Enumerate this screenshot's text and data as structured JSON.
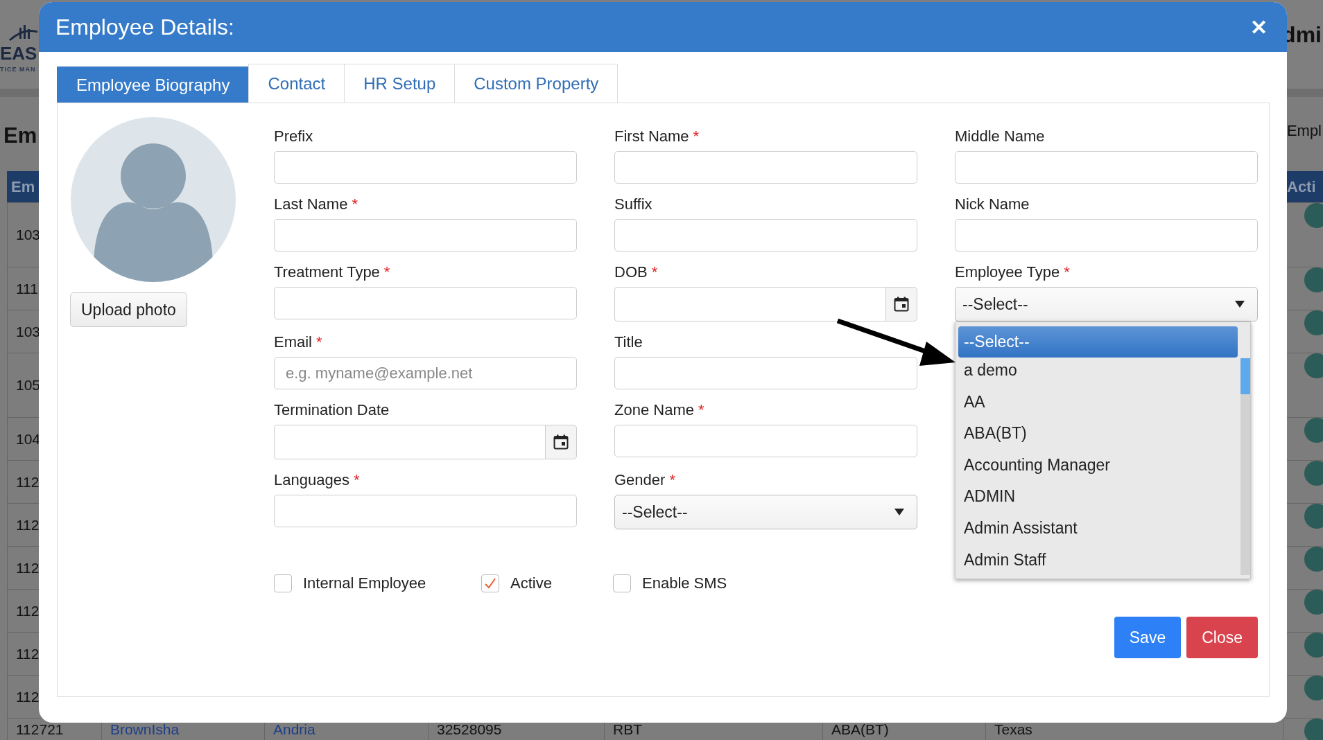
{
  "background_page": {
    "logo": {
      "mark": "EAS",
      "tagline": "TICE MAN"
    },
    "header_text": "dmi",
    "heading": "Em",
    "side_heading": "Empl",
    "table": {
      "header": [
        {
          "label": "Em"
        },
        {
          "label": "Acti"
        }
      ],
      "rows": [
        {
          "cells": [
            {
              "text": "103"
            }
          ]
        },
        {
          "cells": [
            {
              "text": "111"
            }
          ]
        },
        {
          "cells": [
            {
              "text": "103"
            }
          ]
        },
        {
          "cells": [
            {
              "text": "105"
            }
          ]
        },
        {
          "cells": [
            {
              "text": "104"
            }
          ]
        },
        {
          "cells": [
            {
              "text": "112"
            }
          ]
        },
        {
          "cells": [
            {
              "text": "112"
            }
          ]
        },
        {
          "cells": [
            {
              "text": "112"
            }
          ]
        },
        {
          "cells": [
            {
              "text": "112"
            }
          ]
        },
        {
          "cells": [
            {
              "text": "112"
            }
          ]
        },
        {
          "cells": [
            {
              "text": "112"
            }
          ]
        },
        {
          "cells": [
            {
              "text": "112721",
              "link": false
            },
            {
              "text": "BrownIsha",
              "link": true
            },
            {
              "text": "Andria",
              "link": true
            },
            {
              "text": "32528095",
              "link": false
            },
            {
              "text": "RBT",
              "link": false
            },
            {
              "text": "ABA(BT)",
              "link": false
            },
            {
              "text": "Texas",
              "link": false
            }
          ]
        }
      ]
    }
  },
  "dialog": {
    "title": "Employee Details:",
    "close_symbol": "✕",
    "tabs": [
      {
        "label": "Employee Biography",
        "selected": true
      },
      {
        "label": "Contact",
        "selected": false
      },
      {
        "label": "HR Setup",
        "selected": false
      },
      {
        "label": "Custom Property",
        "selected": false
      }
    ],
    "upload_button": "Upload photo",
    "field_rows": [
      [
        {
          "kind": "text",
          "label": "Prefix"
        },
        {
          "kind": "text",
          "label": "First Name",
          "mark": "*"
        },
        {
          "kind": "text",
          "label": "Middle Name"
        }
      ],
      [
        {
          "kind": "text",
          "label": "Last Name",
          "mark": "*"
        },
        {
          "kind": "text",
          "label": "Suffix"
        },
        {
          "kind": "text",
          "label": "Nick Name"
        }
      ],
      [
        {
          "kind": "text",
          "label": "Treatment Type",
          "mark": "*"
        },
        {
          "kind": "date",
          "label": "DOB",
          "mark": "*"
        },
        {
          "kind": "select",
          "label": "Employee Type",
          "mark": "*",
          "value": "--Select--",
          "expanded": true,
          "options": [
            {
              "label": "--Select--",
              "selected": true
            },
            {
              "label": "a demo",
              "selected": false
            },
            {
              "label": "AA",
              "selected": false
            },
            {
              "label": "ABA(BT)",
              "selected": false
            },
            {
              "label": "Accounting Manager",
              "selected": false
            },
            {
              "label": "ADMIN",
              "selected": false
            },
            {
              "label": "Admin Assistant",
              "selected": false
            },
            {
              "label": "Admin Staff",
              "selected": false
            }
          ]
        }
      ],
      [
        {
          "kind": "text",
          "label": "Email",
          "mark": "*",
          "placeholder": "e.g. myname@example.net"
        },
        {
          "kind": "text",
          "label": "Title"
        }
      ],
      [
        {
          "kind": "date",
          "label": "Termination Date"
        },
        {
          "kind": "text",
          "label": "Zone Name",
          "mark": "*"
        }
      ],
      [
        {
          "kind": "text",
          "label": "Languages",
          "mark": "*"
        },
        {
          "kind": "select",
          "label": "Gender",
          "mark": "*",
          "value": "--Select--"
        }
      ]
    ],
    "checkboxes": [
      {
        "label": "Internal Employee",
        "checked": false
      },
      {
        "label": "Active",
        "checked": true
      },
      {
        "label": "Enable SMS",
        "checked": false
      }
    ],
    "buttons": [
      {
        "kind": "primary",
        "label": "Save"
      },
      {
        "kind": "danger",
        "label": "Close"
      }
    ]
  }
}
